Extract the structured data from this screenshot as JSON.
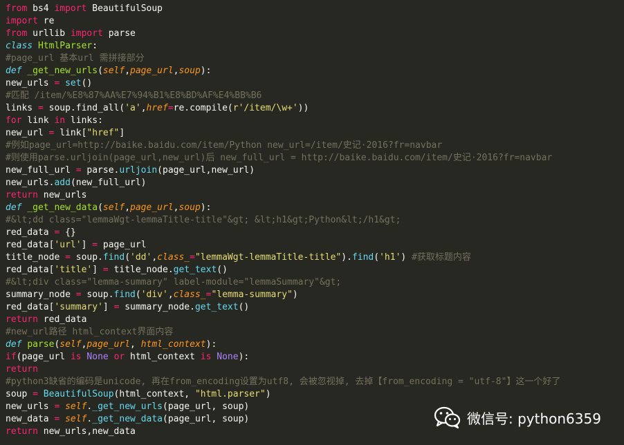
{
  "colors": {
    "background": "#272822",
    "text": "#f8f8f2",
    "keyword": "#f92672",
    "string": "#e6db74",
    "comment": "#75715e",
    "function": "#a6e22e",
    "builtin": "#66d9ef",
    "parameter": "#fd971f",
    "constant": "#ae81ff"
  },
  "code_lines": [
    [
      [
        "k",
        "from"
      ],
      [
        "t",
        " bs4 "
      ],
      [
        "k",
        "import"
      ],
      [
        "t",
        " BeautifulSoup"
      ]
    ],
    [
      [
        "k",
        "import"
      ],
      [
        "t",
        " re"
      ]
    ],
    [
      [
        "k",
        "from"
      ],
      [
        "t",
        " urllib "
      ],
      [
        "k",
        "import"
      ],
      [
        "t",
        " parse"
      ]
    ],
    [
      [
        "i",
        "class"
      ],
      [
        "t",
        " "
      ],
      [
        "f",
        "HtmlParser"
      ],
      [
        "t",
        ":"
      ]
    ],
    [
      [
        "c",
        "#page_url 基本url 需拼接部分"
      ]
    ],
    [
      [
        "i",
        "def"
      ],
      [
        "t",
        " "
      ],
      [
        "f",
        "_get_new_urls"
      ],
      [
        "t",
        "("
      ],
      [
        "p",
        "self"
      ],
      [
        "t",
        ","
      ],
      [
        "p",
        "page_url"
      ],
      [
        "t",
        ","
      ],
      [
        "p",
        "soup"
      ],
      [
        "t",
        "):"
      ]
    ],
    [
      [
        "t",
        "new_urls "
      ],
      [
        "k",
        "="
      ],
      [
        "t",
        " "
      ],
      [
        "b",
        "set"
      ],
      [
        "t",
        "()"
      ]
    ],
    [
      [
        "c",
        "#匹配 /item/%E8%87%AA%E7%94%B1%E8%BD%AF%E4%BB%B6"
      ]
    ],
    [
      [
        "t",
        "links "
      ],
      [
        "k",
        "="
      ],
      [
        "t",
        " soup.find_all("
      ],
      [
        "s",
        "'a'"
      ],
      [
        "t",
        ","
      ],
      [
        "p",
        "href"
      ],
      [
        "k",
        "="
      ],
      [
        "t",
        "re.compile("
      ],
      [
        "s",
        "r'/item/\\w+'"
      ],
      [
        "t",
        "))"
      ]
    ],
    [
      [
        "k",
        "for"
      ],
      [
        "t",
        " link "
      ],
      [
        "k",
        "in"
      ],
      [
        "t",
        " links:"
      ]
    ],
    [
      [
        "t",
        "new_url "
      ],
      [
        "k",
        "="
      ],
      [
        "t",
        " link["
      ],
      [
        "s",
        "\"href\""
      ],
      [
        "t",
        "]"
      ]
    ],
    [
      [
        "c",
        "#例如page_url=http://baike.baidu.com/item/Python new_url=/item/史记·2016?fr=navbar"
      ]
    ],
    [
      [
        "c",
        "#则使用parse.urljoin(page_url,new_url)后 new_full_url = http://baike.baidu.com/item/史记·2016?fr=navbar"
      ]
    ],
    [
      [
        "t",
        "new_full_url "
      ],
      [
        "k",
        "="
      ],
      [
        "t",
        " parse."
      ],
      [
        "b",
        "urljoin"
      ],
      [
        "t",
        "(page_url,new_url)"
      ]
    ],
    [
      [
        "t",
        "new_urls."
      ],
      [
        "b",
        "add"
      ],
      [
        "t",
        "(new_full_url)"
      ]
    ],
    [
      [
        "k",
        "return"
      ],
      [
        "t",
        " new_urls"
      ]
    ],
    [
      [
        "i",
        "def"
      ],
      [
        "t",
        " "
      ],
      [
        "f",
        "_get_new_data"
      ],
      [
        "t",
        "("
      ],
      [
        "p",
        "self"
      ],
      [
        "t",
        ","
      ],
      [
        "p",
        "page_url"
      ],
      [
        "t",
        ","
      ],
      [
        "p",
        "soup"
      ],
      [
        "t",
        "):"
      ]
    ],
    [
      [
        "c",
        "#&lt;dd class=\"lemmaWgt-lemmaTitle-title\"&gt; &lt;h1&gt;Python&lt;/h1&gt;"
      ]
    ],
    [
      [
        "t",
        "red_data "
      ],
      [
        "k",
        "="
      ],
      [
        "t",
        " {}"
      ]
    ],
    [
      [
        "t",
        "red_data["
      ],
      [
        "s",
        "'url'"
      ],
      [
        "t",
        "] "
      ],
      [
        "k",
        "="
      ],
      [
        "t",
        " page_url"
      ]
    ],
    [
      [
        "t",
        "title_node "
      ],
      [
        "k",
        "="
      ],
      [
        "t",
        " soup."
      ],
      [
        "b",
        "find"
      ],
      [
        "t",
        "("
      ],
      [
        "s",
        "'dd'"
      ],
      [
        "t",
        ","
      ],
      [
        "p",
        "class_"
      ],
      [
        "k",
        "="
      ],
      [
        "s",
        "\"lemmaWgt-lemmaTitle-title\""
      ],
      [
        "t",
        ")."
      ],
      [
        "b",
        "find"
      ],
      [
        "t",
        "("
      ],
      [
        "s",
        "'h1'"
      ],
      [
        "t",
        ") "
      ],
      [
        "c",
        "#获取标题内容"
      ]
    ],
    [
      [
        "t",
        "red_data["
      ],
      [
        "s",
        "'title'"
      ],
      [
        "t",
        "] "
      ],
      [
        "k",
        "="
      ],
      [
        "t",
        " title_node."
      ],
      [
        "b",
        "get_text"
      ],
      [
        "t",
        "()"
      ]
    ],
    [
      [
        "c",
        "#&lt;div class=\"lemma-summary\" label-module=\"lemmaSummary\"&gt;"
      ]
    ],
    [
      [
        "t",
        "summary_node "
      ],
      [
        "k",
        "="
      ],
      [
        "t",
        " soup."
      ],
      [
        "b",
        "find"
      ],
      [
        "t",
        "("
      ],
      [
        "s",
        "'div'"
      ],
      [
        "t",
        ","
      ],
      [
        "p",
        "class_"
      ],
      [
        "k",
        "="
      ],
      [
        "s",
        "\"lemma-summary\""
      ],
      [
        "t",
        ")"
      ]
    ],
    [
      [
        "t",
        "red_data["
      ],
      [
        "s",
        "'summary'"
      ],
      [
        "t",
        "] "
      ],
      [
        "k",
        "="
      ],
      [
        "t",
        " summary_node."
      ],
      [
        "b",
        "get_text"
      ],
      [
        "t",
        "()"
      ]
    ],
    [
      [
        "k",
        "return"
      ],
      [
        "t",
        " red_data"
      ]
    ],
    [
      [
        "c",
        "#new_url路径 html_context界面内容"
      ]
    ],
    [
      [
        "i",
        "def"
      ],
      [
        "t",
        " "
      ],
      [
        "f",
        "parse"
      ],
      [
        "t",
        "("
      ],
      [
        "p",
        "self"
      ],
      [
        "t",
        ","
      ],
      [
        "p",
        "page_url"
      ],
      [
        "t",
        ", "
      ],
      [
        "p",
        "html_context"
      ],
      [
        "t",
        "):"
      ]
    ],
    [
      [
        "k",
        "if"
      ],
      [
        "t",
        "(page_url "
      ],
      [
        "k",
        "is"
      ],
      [
        "t",
        " "
      ],
      [
        "n",
        "None"
      ],
      [
        "t",
        " "
      ],
      [
        "k",
        "or"
      ],
      [
        "t",
        " html_context "
      ],
      [
        "k",
        "is"
      ],
      [
        "t",
        " "
      ],
      [
        "n",
        "None"
      ],
      [
        "t",
        "):"
      ]
    ],
    [
      [
        "k",
        "return"
      ]
    ],
    [
      [
        "c",
        "#python3缺省的编码是unicode, 再在from_encoding设置为utf8, 会被忽视掉, 去掉【from_encoding = \"utf-8\"】这一个好了"
      ]
    ],
    [
      [
        "t",
        "soup "
      ],
      [
        "k",
        "="
      ],
      [
        "t",
        " "
      ],
      [
        "b",
        "BeautifulSoup"
      ],
      [
        "t",
        "(html_context, "
      ],
      [
        "s",
        "\"html.parser\""
      ],
      [
        "t",
        ")"
      ]
    ],
    [
      [
        "t",
        "new_urls "
      ],
      [
        "k",
        "="
      ],
      [
        "t",
        " "
      ],
      [
        "p",
        "self"
      ],
      [
        "t",
        "."
      ],
      [
        "b",
        "_get_new_urls"
      ],
      [
        "t",
        "(page_url, soup)"
      ]
    ],
    [
      [
        "t",
        "new_data "
      ],
      [
        "k",
        "="
      ],
      [
        "t",
        " "
      ],
      [
        "p",
        "self"
      ],
      [
        "t",
        "."
      ],
      [
        "b",
        "_get_new_data"
      ],
      [
        "t",
        "(page_url, soup)"
      ]
    ],
    [
      [
        "k",
        "return"
      ],
      [
        "t",
        " new_urls,new_data"
      ]
    ]
  ],
  "watermark": {
    "icon": "wechat-icon",
    "text": "微信号: python6359"
  }
}
